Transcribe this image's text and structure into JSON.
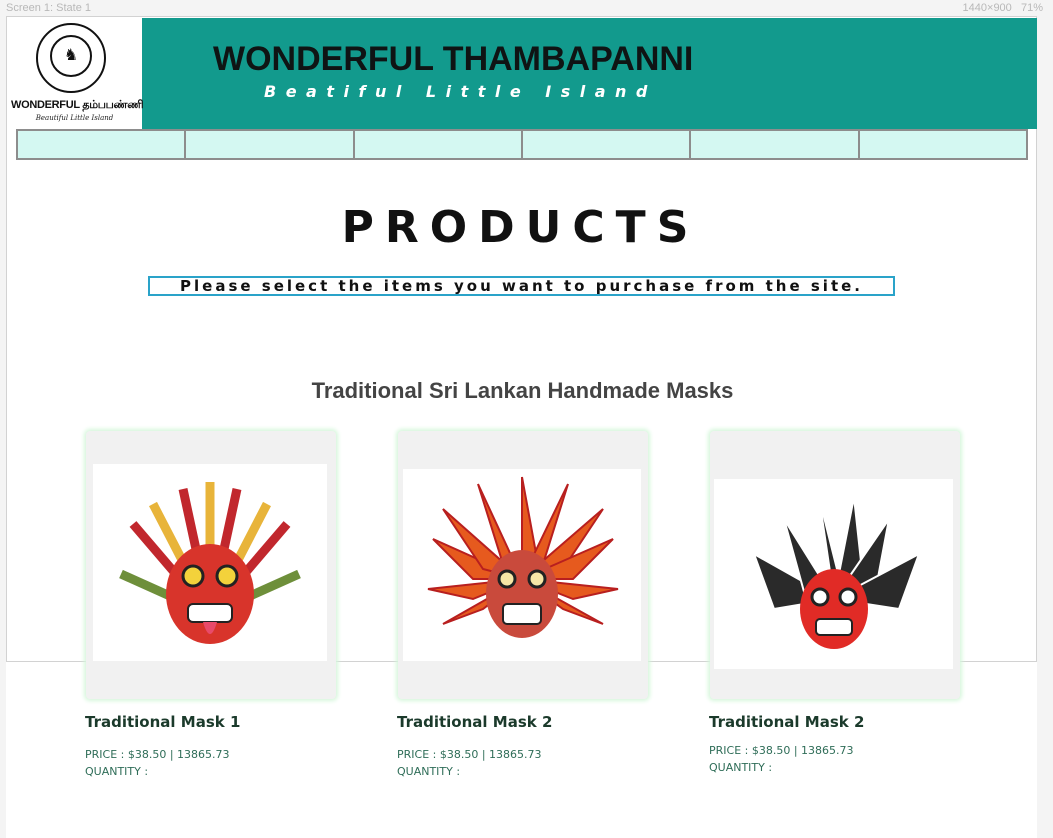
{
  "editor": {
    "screen_label": "Screen 1: State 1",
    "size_label": "1440×900",
    "zoom_label": "71%"
  },
  "header": {
    "logo_word": "WONDERFUL தம்பபண்ணி",
    "logo_tagline": "Beautiful Little Island",
    "title": "WONDERFUL THAMBAPANNI",
    "subtitle": "Beatiful Little Island",
    "colors": {
      "band": "#129a8d",
      "nav": "#d4f8f2"
    }
  },
  "nav": {
    "items": [
      "",
      "",
      "",
      "",
      "",
      ""
    ]
  },
  "main": {
    "heading": "PRODUCTS",
    "instruction": "Please select the items you want to purchase from the site.",
    "section_title": "Traditional Sri Lankan Handmade Masks"
  },
  "products": [
    {
      "name": "Traditional Mask 1",
      "price": "PRICE : $38.50  | 13865.73",
      "quantity": "QUANTITY :",
      "image": "mask-icon"
    },
    {
      "name": "Traditional Mask 2",
      "price": "PRICE : $38.50  | 13865.73",
      "quantity": "QUANTITY :",
      "image": "mask-icon"
    },
    {
      "name": "Traditional Mask 2",
      "price": "PRICE : $38.50  | 13865.73",
      "quantity": "QUANTITY :",
      "image": "mask-icon"
    }
  ]
}
